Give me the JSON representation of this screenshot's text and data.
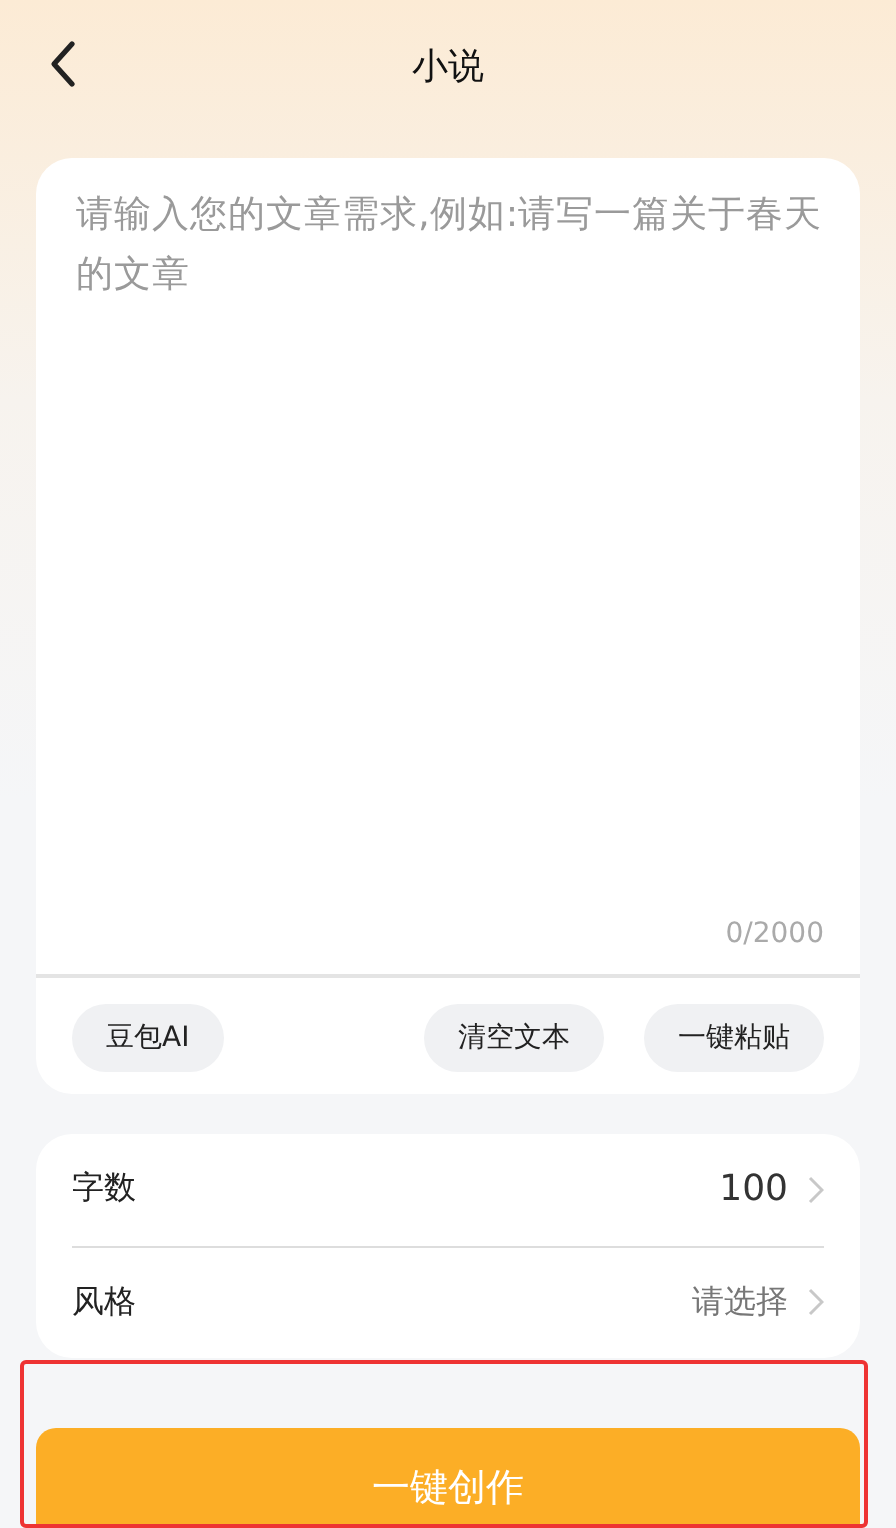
{
  "header": {
    "title": "小说"
  },
  "editor": {
    "placeholder": "请输入您的文章需求,例如:请写一篇关于春天的文章",
    "counter": "0/2000",
    "buttons": [
      "豆包AI",
      "清空文本",
      "一键粘贴"
    ]
  },
  "settings": [
    {
      "label": "字数",
      "value": "100",
      "kind": "value"
    },
    {
      "label": "风格",
      "value": "请选择",
      "kind": "placeholder"
    }
  ],
  "submit": {
    "label": "一键创作"
  },
  "highlight": true
}
